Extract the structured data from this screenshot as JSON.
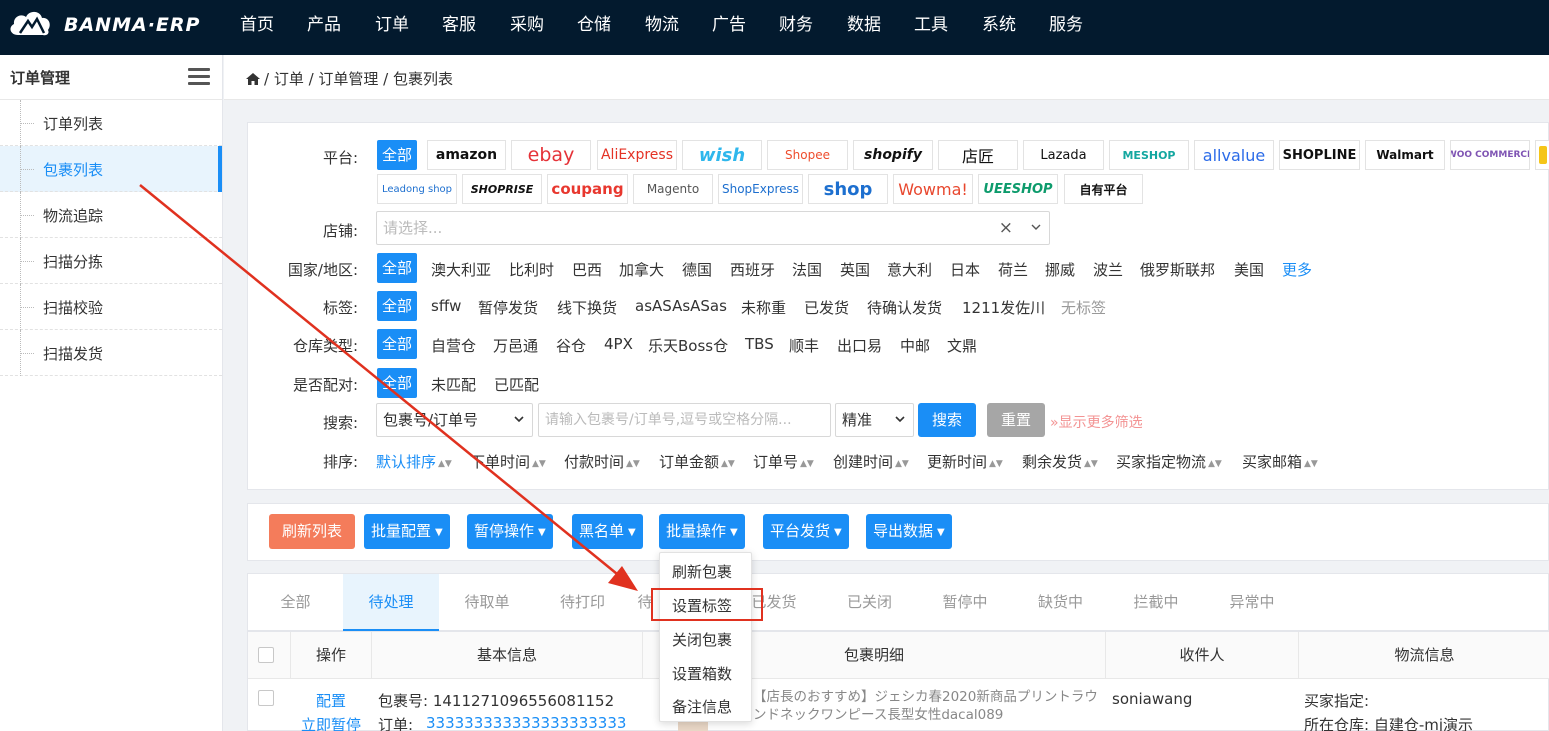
{
  "brand": {
    "name": "BANMA·ERP",
    "logo": "cloud-logo"
  },
  "topnav": [
    "首页",
    "产品",
    "订单",
    "客服",
    "采购",
    "仓储",
    "物流",
    "广告",
    "财务",
    "数据",
    "工具",
    "系统",
    "服务"
  ],
  "sidebar": {
    "title": "订单管理",
    "items": [
      {
        "label": "订单列表"
      },
      {
        "label": "包裹列表"
      },
      {
        "label": "物流追踪"
      },
      {
        "label": "扫描分拣"
      },
      {
        "label": "扫描校验"
      },
      {
        "label": "扫描发货"
      }
    ],
    "active_index": 1
  },
  "breadcrumb": {
    "icon": "home-icon",
    "text": "/ 订单 / 订单管理 / 包裹列表"
  },
  "filters": {
    "platform_label": "平台:",
    "all_label": "全部",
    "platforms_row1": [
      "amazon",
      "ebay",
      "AliExpress",
      "wish",
      "Shopee",
      "shopify",
      "店匠",
      "Lazada",
      "MESHOP",
      "allvalue",
      "SHOPLINE",
      "Walmart",
      "WOO COMMERCE"
    ],
    "platforms_row2": [
      "Leadong shop",
      "SHOPRISE",
      "coupang",
      "Magento",
      "ShopExpress",
      "shop",
      "Wowma!",
      "UEESHOP",
      "自有平台"
    ],
    "store_label": "店铺:",
    "store_placeholder": "请选择...",
    "country_label": "国家/地区:",
    "countries": [
      "澳大利亚",
      "比利时",
      "巴西",
      "加拿大",
      "德国",
      "西班牙",
      "法国",
      "英国",
      "意大利",
      "日本",
      "荷兰",
      "挪威",
      "波兰",
      "俄罗斯联邦",
      "美国"
    ],
    "more_label": "更多",
    "tag_label": "标签:",
    "tags": [
      "sffw",
      "暂停发货",
      "线下换货",
      "asASAsASas",
      "未称重",
      "已发货",
      "待确认发货",
      "1211发佐川"
    ],
    "no_tag": "无标签",
    "warehouse_label": "仓库类型:",
    "warehouses": [
      "自营仓",
      "万邑通",
      "谷仓",
      "4PX",
      "乐天Boss仓",
      "TBS",
      "顺丰",
      "出口易",
      "中邮",
      "文鼎"
    ],
    "match_label": "是否配对:",
    "matches": [
      "未匹配",
      "已匹配"
    ],
    "search_label": "搜索:",
    "search_field": "包裹号/订单号",
    "search_placeholder": "请输入包裹号/订单号,逗号或空格分隔...",
    "search_mode": "精准",
    "search_btn": "搜索",
    "reset_btn": "重置",
    "more_filter": "显示更多筛选",
    "sort_label": "排序:",
    "sorts": [
      "默认排序",
      "下单时间",
      "付款时间",
      "订单金额",
      "订单号",
      "创建时间",
      "更新时间",
      "剩余发货",
      "买家指定物流",
      "买家邮箱"
    ]
  },
  "toolbar": {
    "refresh": "刷新列表",
    "buttons": [
      "批量配置",
      "暂停操作",
      "黑名单",
      "批量操作",
      "平台发货",
      "导出数据"
    ]
  },
  "dropdown": {
    "items": [
      "刷新包裹",
      "设置标签",
      "关闭包裹",
      "设置箱数",
      "备注信息"
    ],
    "highlighted_index": 1
  },
  "tabs": {
    "items": [
      "全部",
      "待处理",
      "待取单",
      "待打印",
      "待",
      "已发货",
      "已关闭",
      "暂停中",
      "缺货中",
      "拦截中",
      "异常中"
    ],
    "active_index": 1
  },
  "table": {
    "headers": [
      "操作",
      "基本信息",
      "包裹明细",
      "收件人",
      "物流信息"
    ],
    "row": {
      "actions": [
        "配置",
        "立即暂停"
      ],
      "package_no": "包裹号: 1411271096556081152",
      "order_label": "订单: ",
      "order_no": "333333333333333333333",
      "product": "【店長のおすすめ】ジェシカ春2020新商品プリントラウンドネックワンピース長型女性dacal089",
      "recipient": "soniawang",
      "logistics_1": "买家指定:",
      "logistics_2": "所在仓库: 自建仓-mj演示"
    }
  },
  "colors": {
    "primary": "#1a8ef6",
    "nav_bg": "#031a2e",
    "refresh_btn": "#f47c5b",
    "annotation": "#e0311f"
  }
}
